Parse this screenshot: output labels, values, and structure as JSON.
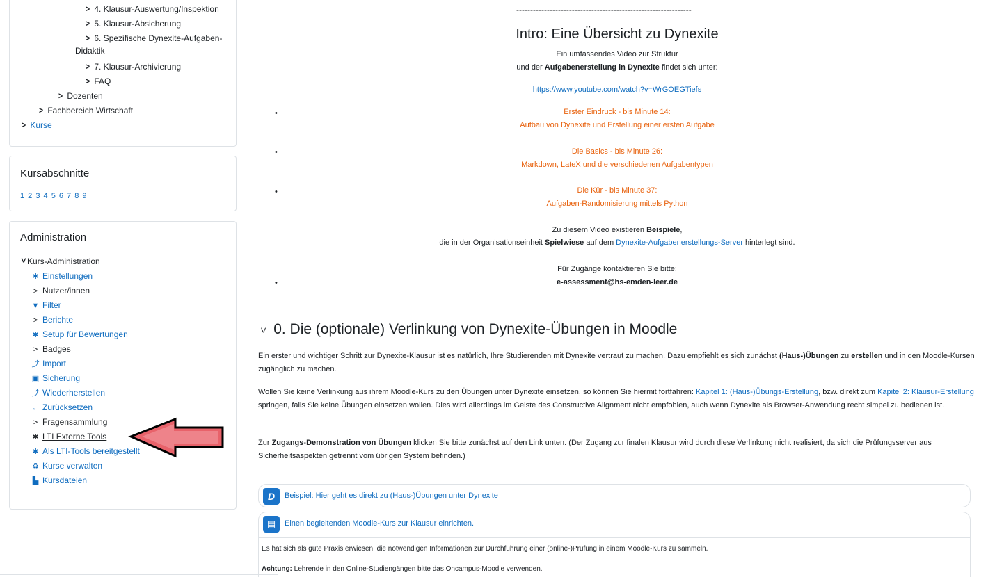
{
  "nav": {
    "items": [
      {
        "label": "4. Klausur-Auswertung/Inspektion"
      },
      {
        "label": "5. Klausur-Absicherung"
      },
      {
        "label": "6. Spezifische Dynexite-Aufgaben-"
      },
      {
        "label": "Didaktik"
      },
      {
        "label": "7. Klausur-Archivierung"
      },
      {
        "label": "FAQ"
      },
      {
        "label": "Dozenten"
      },
      {
        "label": "Fachbereich Wirtschaft"
      },
      {
        "label": "Kurse"
      }
    ]
  },
  "sections": {
    "title": "Kursabschnitte",
    "list": "1 2 3 4 5 6 7 8 9"
  },
  "admin": {
    "title": "Administration",
    "kurs_admin": "Kurs-Administration",
    "items": [
      {
        "label": "Einstellungen",
        "icon": "gear-icon"
      },
      {
        "label": "Nutzer/innen",
        "icon": "chevron-right-icon"
      },
      {
        "label": "Filter",
        "icon": "filter-icon"
      },
      {
        "label": "Berichte",
        "icon": "chevron-right-icon"
      },
      {
        "label": "Setup für Bewertungen",
        "icon": "gear-icon"
      },
      {
        "label": "Badges",
        "icon": "chevron-right-icon"
      },
      {
        "label": "Import",
        "icon": "import-icon"
      },
      {
        "label": "Sicherung",
        "icon": "backup-icon"
      },
      {
        "label": "Wiederherstellen",
        "icon": "restore-icon"
      },
      {
        "label": "Zurücksetzen",
        "icon": "arrow-left-icon"
      },
      {
        "label": "Fragensammlung",
        "icon": "chevron-right-icon"
      },
      {
        "label": "LTI Externe Tools",
        "icon": "gear-icon"
      },
      {
        "label": "Als LTI-Tools bereitgestellt",
        "icon": "gear-icon"
      },
      {
        "label": "Kurse verwalten",
        "icon": "recycle-icon"
      },
      {
        "label": "Kursdateien",
        "icon": "chart-icon"
      }
    ]
  },
  "main": {
    "dashes": "---------------------------------------------------------------",
    "intro_title": "Intro: Eine Übersicht zu Dynexite",
    "intro_line1": "Ein umfassendes Video zur Struktur",
    "intro_line2_pre": "und der ",
    "intro_line2_bold": "Aufgabenerstellung in Dynexite",
    "intro_line2_post": " findet sich unter:",
    "youtube_link": "https://www.youtube.com/watch?v=WrGOEGTiefs",
    "bullets": [
      {
        "line1": "Erster Eindruck - bis Minute 14:",
        "line2": "Aufbau von Dynexite und Erstellung einer ersten Aufgabe"
      },
      {
        "line1": "Die Basics - bis Minute 26:",
        "line2": "Markdown, LateX und die verschiedenen Aufgabentypen"
      },
      {
        "line1": "Die Kür - bis Minute 37:",
        "line2": "Aufgaben-Randomisierung mittels Python"
      }
    ],
    "examples_pre": "Zu diesem Video existieren ",
    "examples_bold": "Beispiele",
    "examples_post": ",",
    "org_pre": "die in der Organisationseinheit ",
    "org_bold": "Spielwiese",
    "org_mid": " auf dem ",
    "org_link": "Dynexite-Aufgabenerstellungs-Server",
    "org_post": " hinterlegt sind.",
    "contact_line": "Für Zugänge kontaktieren Sie bitte:",
    "contact_email": "e-assessment@hs-emden-leer.de",
    "section_title": "0. Die (optionale) Verlinkung von Dynexite-Übungen in Moodle",
    "p1_a": "Ein erster und wichtiger Schritt zur Dynexite-Klausur ist es natürlich, Ihre Studierenden mit Dynexite vertraut zu machen. Dazu empfiehlt es sich zunächst ",
    "p1_b": "(Haus-)Übungen",
    "p1_c": " zu ",
    "p1_d": "erstellen",
    "p1_e": " und in den Moodle-Kursen zugänglich zu machen.",
    "p2_a": "Wollen Sie keine Verlinkung aus ihrem Moodle-Kurs zu den Übungen unter Dynexite einsetzen, so können Sie hiermit fortfahren: ",
    "p2_link1": "Kapitel 1: (Haus-)Übungs-Erstellung",
    "p2_b": ", bzw. direkt zum ",
    "p2_link2": "Kapitel 2: Klausur-Erstellung",
    "p2_c": " springen, falls Sie keine Übungen einsetzen wollen. Dies wird allerdings im Geiste des Constructive Alignment nicht empfohlen, auch wenn Dynexite als Browser-Anwendung recht simpel zu bedienen ist.",
    "p3_a": "Zur ",
    "p3_b": "Zugangs",
    "p3_c": "-",
    "p3_d": "Demonstration von Übungen",
    "p3_e": " klicken Sie bitte zunächst auf den Link unten. (Der Zugang zur finalen Klausur wird durch diese Verlinkung nicht realisiert, da sich die Prüfungsserver aus Sicherheitsaspekten getrennt vom übrigen System befinden.)",
    "activity1": "Beispiel: Hier geht es direkt zu (Haus-)Übungen unter Dynexite",
    "activity2": "Einen begleitenden Moodle-Kurs zur Klausur einrichten.",
    "act2_text1": "Es hat sich als gute Praxis erwiesen, die notwendigen Informationen zur Durchführung einer (online-)Prüfung in einem Moodle-Kurs zu sammeln.",
    "act2_text2_bold": "Achtung:",
    "act2_text2": " Lehrende in den Online-Studiengängen bitte das Oncampus-Moodle verwenden."
  },
  "colors": {
    "link": "#0f6cbf",
    "orange": "#e8620e",
    "arrow": "#e8323c"
  }
}
